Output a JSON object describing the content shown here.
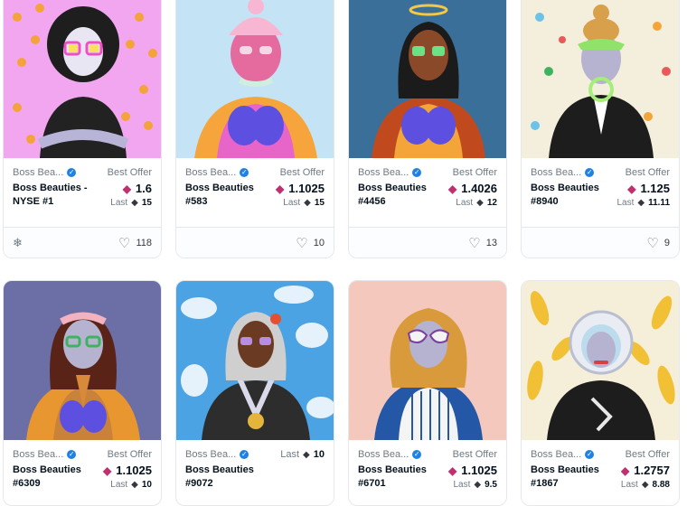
{
  "collection": "Boss Bea...",
  "cards": [
    {
      "collection": "Boss Bea...",
      "name": "Boss Beauties - NYSE #1",
      "price_label": "Best Offer",
      "price": "1.6",
      "last_label": "Last",
      "last": "15",
      "favorites": "118",
      "show_footer_icon": true
    },
    {
      "collection": "Boss Bea...",
      "name": "Boss Beauties #583",
      "price_label": "Best Offer",
      "price": "1.1025",
      "last_label": "Last",
      "last": "15",
      "favorites": "10"
    },
    {
      "collection": "Boss Bea...",
      "name": "Boss Beauties #4456",
      "price_label": "Best Offer",
      "price": "1.4026",
      "last_label": "Last",
      "last": "12",
      "favorites": "13"
    },
    {
      "collection": "Boss Bea...",
      "name": "Boss Beauties #8940",
      "price_label": "Best Offer",
      "price": "1.125",
      "last_label": "Last",
      "last": "11.11",
      "favorites": "9"
    },
    {
      "collection": "Boss Bea...",
      "name": "Boss Beauties #6309",
      "price_label": "Best Offer",
      "price": "1.1025",
      "last_label": "Last",
      "last": "10"
    },
    {
      "collection": "Boss Bea...",
      "name": "Boss Beauties #9072",
      "price_label": "",
      "price": "",
      "last_label": "Last",
      "last": "10"
    },
    {
      "collection": "Boss Bea...",
      "name": "Boss Beauties #6701",
      "price_label": "Best Offer",
      "price": "1.1025",
      "last_label": "Last",
      "last": "9.5"
    },
    {
      "collection": "Boss Bea...",
      "name": "Boss Beauties #1867",
      "price_label": "Best Offer",
      "price": "1.2757",
      "last_label": "Last",
      "last": "8.88"
    }
  ],
  "icons": {
    "verified": "verified-badge-icon",
    "eth": "ethereum-icon",
    "heart": "heart-icon",
    "snowflake": "snowflake-icon"
  },
  "colors": {
    "accent_blue": "#2081e2",
    "eth_pink": "#c0306e",
    "muted": "#707a83"
  }
}
